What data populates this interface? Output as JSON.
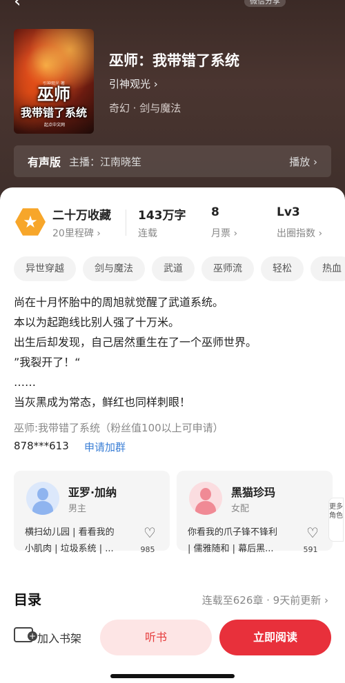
{
  "header": {
    "back_icon": "back-arrow-icon",
    "share_label": "微信分享"
  },
  "book": {
    "cover": {
      "title_line1": "巫师",
      "title_line2": "我带错了系统",
      "author_small": "引神观光 著",
      "badge": "起点中文网"
    },
    "title": "巫师：我带错了系统",
    "author": "引神观光",
    "genre": "奇幻 · 剑与魔法"
  },
  "audio": {
    "label": "有声版",
    "host": "主播：江南晓笙",
    "play": "播放"
  },
  "stats": {
    "collect": "二十万收藏",
    "milestone": "20里程碑",
    "words": "143万字",
    "status": "连载",
    "tickets": "8",
    "tickets_label": "月票",
    "level": "Lv3",
    "level_label": "出圈指数"
  },
  "tags": [
    "异世穿越",
    "剑与魔法",
    "武道",
    "巫师流",
    "轻松",
    "热血"
  ],
  "synopsis": [
    "尚在十月怀胎中的周旭就觉醒了武道系统。",
    "本以为起跑线比别人强了十万米。",
    "出生后却发现，自己居然重生在了一个巫师世界。",
    "”我裂开了！“",
    "……",
    "当灰黑成为常态，鲜红也同样刺眼！"
  ],
  "group": {
    "note": "巫师:我带错了系统（粉丝值100以上可申请）",
    "qq": "878***613",
    "join": "申请加群"
  },
  "characters": [
    {
      "name": "亚罗·加纳",
      "role": "男主",
      "desc_line1": "横扫幼儿园 | 看看我的",
      "desc_line2": "小肌肉 | 垃圾系统 | ...",
      "likes": "985",
      "avatar_color": "#8fb4ef"
    },
    {
      "name": "黑猫珍玛",
      "role": "女配",
      "desc_line1": "你看我的爪子锋不锋利",
      "desc_line2": "| 儒雅随和 | 幕后黑...",
      "likes": "591",
      "avatar_color": "#f08a95"
    }
  ],
  "more_roles": "更多角色",
  "toc": {
    "title": "目录",
    "info": "连载至626章 · 9天前更新"
  },
  "bottom": {
    "shelf": "加入书架",
    "listen": "听书",
    "read": "立即阅读"
  },
  "colors": {
    "accent": "#e8303b",
    "link": "#3b7fd6",
    "badge": "#f7a62a"
  }
}
